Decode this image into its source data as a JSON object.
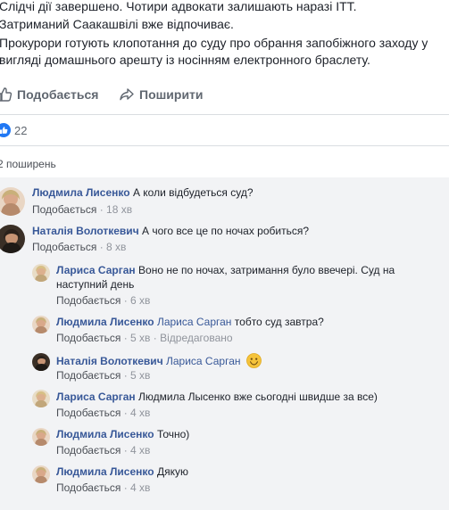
{
  "post": {
    "lines": [
      "Слідчі дії завершено. Чотири адвокати залишають наразі ІТТ.",
      "Затриманий Саакашвілі вже відпочиває.",
      "Прокурори готують клопотання до суду про обрання запобіжного заходу у",
      "вигляді домашнього арешту із носінням електронного браслету."
    ]
  },
  "actions": {
    "like_label": "Подобається",
    "share_label": "Поширити"
  },
  "reactions": {
    "count": "22"
  },
  "shares": {
    "label": "2 поширень"
  },
  "meta_labels": {
    "like": "Подобається",
    "sep": "·",
    "edited": "Відредаговано"
  },
  "comments": [
    {
      "author": "Людмила Лисенко",
      "text": "А коли відбудеться суд?",
      "time": "18 хв"
    },
    {
      "author": "Наталія Волоткевич",
      "text": "А чого все це по ночах робиться?",
      "time": "8 хв"
    }
  ],
  "replies": [
    {
      "author": "Лариса Сарган",
      "text_line1": "Воно не по ночах, затримання було ввечері. Суд на",
      "text_line2": "наступний день",
      "time": "6 хв"
    },
    {
      "author": "Людмила Лисенко",
      "mention": "Лариса Сарган",
      "text": "тобто суд завтра?",
      "time": "5 хв"
    },
    {
      "author": "Наталія Волоткевич",
      "mention": "Лариса Сарган",
      "text": "",
      "time": "5 хв"
    },
    {
      "author": "Лариса Сарган",
      "text": "Людмила Лысенко вже сьогодні швидше за все)",
      "time": "4 хв"
    },
    {
      "author": "Людмила Лисенко",
      "text": "Точно)",
      "time": "4 хв"
    },
    {
      "author": "Людмила Лисенко",
      "text": "Дякую",
      "time": "4 хв"
    }
  ],
  "colors": {
    "link": "#385898",
    "meta": "#90949c",
    "accent": "#2078f4",
    "thread_bg": "#f2f3f5"
  },
  "icons": {
    "like": "thumbs-up-icon",
    "share": "share-arrow-icon",
    "reaction": "like-reaction-icon",
    "emoji": "smile-emoji-icon"
  }
}
